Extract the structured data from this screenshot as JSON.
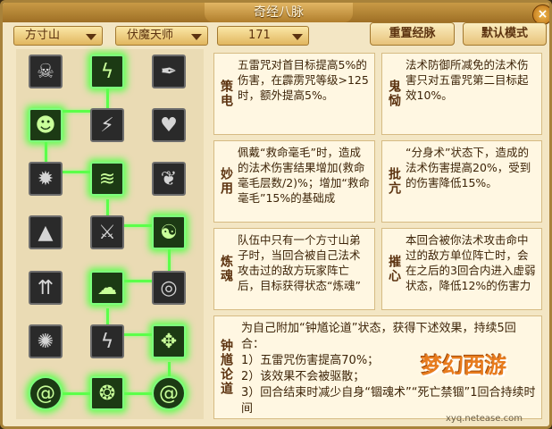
{
  "window": {
    "title": "奇经八脉",
    "close_label": "×"
  },
  "filters": {
    "school": "方寸山",
    "path": "伏魔天师",
    "level": "171"
  },
  "buttons": {
    "reset": "重置经脉",
    "default_mode": "默认模式"
  },
  "skills": [
    {
      "label": "策电",
      "text": "五雷咒对首目标提高5%的伤害，在霹雳咒等级>125时，额外提高5%。"
    },
    {
      "label": "鬼恸",
      "text": "法术防御所减免的法术伤害只对五雷咒第二目标起效10%。"
    },
    {
      "label": "妙用",
      "text": "佩戴“救命毫毛”时，造成的法术伤害结果增加(救命毫毛层数/2)%；增加“救命毫毛”15%的基础成"
    },
    {
      "label": "批亢",
      "text": "“分身术”状态下，造成的法术伤害提高20%，受到的伤害降低15%。"
    },
    {
      "label": "炼魂",
      "text": "队伍中只有一个方寸山弟子时，当回合被自己法术攻击过的敌方玩家阵亡后，目标获得状态“炼魂”"
    },
    {
      "label": "摧心",
      "text": "本回合被你法术攻击命中过的敌方单位阵亡时，会在之后的3回合内进入虚弱状态，降低12%的伤害力"
    },
    {
      "label": "钟馗论道",
      "lines": [
        "为自己附加“钟馗论道”状态，获得下述效果，持续5回合：",
        "1）五雷咒伤害提高70%；",
        "2）该效果不会被驱散；",
        "3）回合结束时减少自身“锢魂术”“死亡禁锢”1回合持续时间"
      ]
    }
  ],
  "tree_icons": [
    "demon-mask-icon",
    "lightning-rune-icon",
    "scroll-icon",
    "monkey-face-icon",
    "lightning-strike-icon",
    "broken-heart-icon",
    "flame-icon",
    "flame-wave-icon",
    "feather-icon",
    "mountain-icon",
    "thunder-claw-icon",
    "meditating-figures-icon",
    "arrows-up-icon",
    "cloud-spirit-icon",
    "swirl-disc-icon",
    "ring-of-fire-icon",
    "lightning-tree-icon",
    "dragon-seal-icon",
    "dragon-orb-icon",
    "three-dragons-icon",
    "dragon-coil-icon"
  ],
  "watermark": {
    "logo": "梦幻西游",
    "url": "xyq.netease.com"
  }
}
